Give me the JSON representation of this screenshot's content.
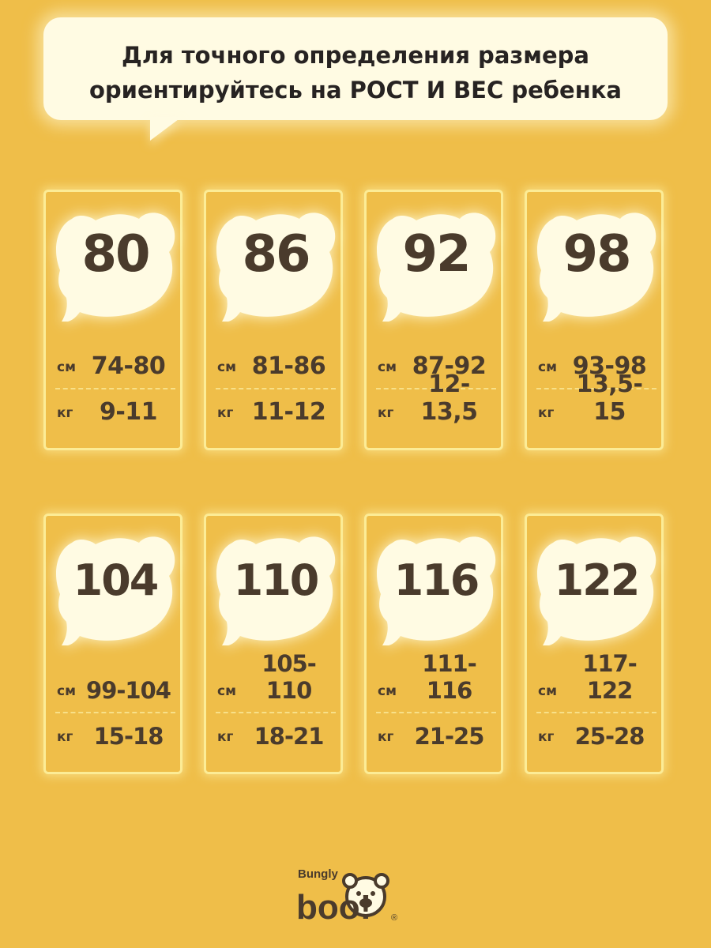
{
  "header": {
    "line1": "Для точного определения размера",
    "line2": "ориентируйтесь на РОСТ И ВЕС ребенка"
  },
  "units": {
    "cm": "см",
    "kg": "кг"
  },
  "sizes": [
    {
      "size": "80",
      "cm": "74-80",
      "kg": "9-11"
    },
    {
      "size": "86",
      "cm": "81-86",
      "kg": "11-12"
    },
    {
      "size": "92",
      "cm": "87-92",
      "kg": "12-13,5"
    },
    {
      "size": "98",
      "cm": "93-98",
      "kg": "13,5-15"
    },
    {
      "size": "104",
      "cm": "99-104",
      "kg": "15-18"
    },
    {
      "size": "110",
      "cm": "105-110",
      "kg": "18-21"
    },
    {
      "size": "116",
      "cm": "111-116",
      "kg": "21-25"
    },
    {
      "size": "122",
      "cm": "117-122",
      "kg": "25-28"
    }
  ],
  "logo": {
    "small": "Bungly",
    "big": "boo!",
    "reg": "®"
  },
  "colors": {
    "background": "#efbe49",
    "bubble": "#fffbe3",
    "text": "#4a3b2c",
    "card_border": "#fcec96"
  }
}
